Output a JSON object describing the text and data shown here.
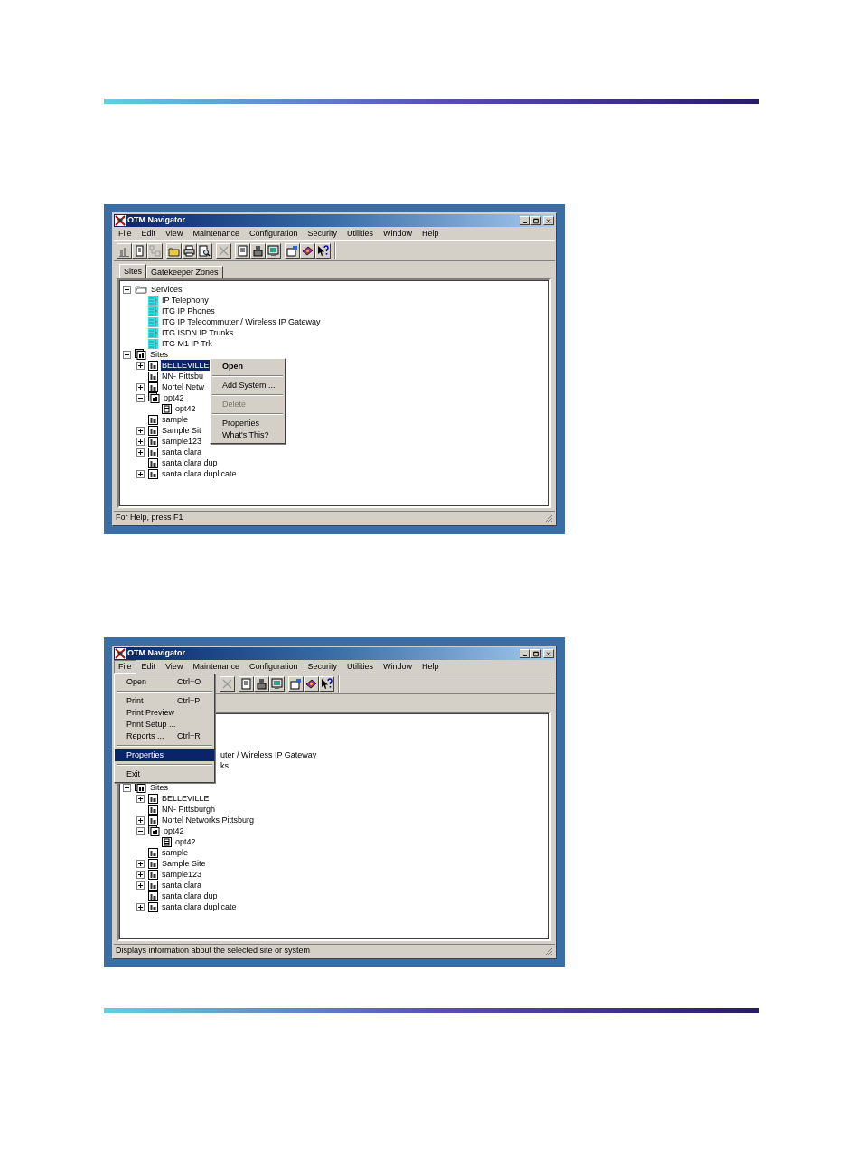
{
  "windows": [
    {
      "title": "OTM Navigator",
      "menu_bar": [
        {
          "label": "File",
          "selected": false
        },
        {
          "label": "Edit",
          "selected": false
        },
        {
          "label": "View",
          "selected": false
        },
        {
          "label": "Maintenance",
          "selected": false
        },
        {
          "label": "Configuration",
          "selected": false
        },
        {
          "label": "Security",
          "selected": false
        },
        {
          "label": "Utilities",
          "selected": false
        },
        {
          "label": "Window",
          "selected": false
        },
        {
          "label": "Help",
          "selected": false
        }
      ],
      "tabs": [
        {
          "label": "Sites",
          "selected": true
        },
        {
          "label": "Gatekeeper Zones",
          "selected": false
        }
      ],
      "tree": [
        {
          "kind": "folder",
          "label": "Services",
          "expanded": true,
          "selected": false,
          "children": [
            {
              "kind": "service",
              "label": "IP Telephony",
              "selected": false
            },
            {
              "kind": "service",
              "label": "ITG IP Phones",
              "selected": false
            },
            {
              "kind": "service",
              "label": "ITG IP Telecommuter / Wireless IP Gateway",
              "selected": false
            },
            {
              "kind": "service",
              "label": "ITG ISDN IP Trunks",
              "selected": false
            },
            {
              "kind": "service",
              "label": "ITG M1 IP Trk",
              "selected": false
            }
          ]
        },
        {
          "kind": "sites",
          "label": "Sites",
          "expanded": true,
          "selected": false,
          "children": [
            {
              "kind": "site",
              "label": "BELLEVILLE",
              "expanded": false,
              "selected": true
            },
            {
              "kind": "site",
              "label": "NN- Pittsbu",
              "selected": false
            },
            {
              "kind": "site",
              "label": "Nortel Netw",
              "expanded": false,
              "selected": false
            },
            {
              "kind": "sites",
              "label": "opt42",
              "expanded": true,
              "selected": false,
              "children": [
                {
                  "kind": "system",
                  "label": "opt42",
                  "selected": false
                }
              ]
            },
            {
              "kind": "site",
              "label": "sample",
              "selected": false
            },
            {
              "kind": "site",
              "label": "Sample Sit",
              "expanded": false,
              "selected": false
            },
            {
              "kind": "site",
              "label": "sample123",
              "expanded": false,
              "selected": false
            },
            {
              "kind": "site",
              "label": "santa clara",
              "expanded": false,
              "selected": false
            },
            {
              "kind": "site",
              "label": "santa clara dup",
              "selected": false
            },
            {
              "kind": "site",
              "label": "santa clara duplicate",
              "expanded": false,
              "selected": false
            }
          ]
        }
      ],
      "context_menu": [
        {
          "kind": "item",
          "label": "Open",
          "default": true,
          "disabled": false,
          "selected": false
        },
        {
          "kind": "separator"
        },
        {
          "kind": "item",
          "label": "Add System ...",
          "default": false,
          "disabled": false,
          "selected": false
        },
        {
          "kind": "separator"
        },
        {
          "kind": "item",
          "label": "Delete",
          "default": false,
          "disabled": true,
          "selected": false
        },
        {
          "kind": "separator"
        },
        {
          "kind": "item",
          "label": "Properties",
          "default": false,
          "disabled": false,
          "selected": false
        },
        {
          "kind": "item",
          "label": "What's This?",
          "default": false,
          "disabled": false,
          "selected": false
        }
      ],
      "status_bar": "For Help, press F1"
    },
    {
      "title": "OTM Navigator",
      "menu_bar": [
        {
          "label": "File",
          "selected": true
        },
        {
          "label": "Edit",
          "selected": false
        },
        {
          "label": "View",
          "selected": false
        },
        {
          "label": "Maintenance",
          "selected": false
        },
        {
          "label": "Configuration",
          "selected": false
        },
        {
          "label": "Security",
          "selected": false
        },
        {
          "label": "Utilities",
          "selected": false
        },
        {
          "label": "Window",
          "selected": false
        },
        {
          "label": "Help",
          "selected": false
        }
      ],
      "file_menu": [
        {
          "kind": "item",
          "label": "Open",
          "shortcut": "Ctrl+O",
          "selected": false
        },
        {
          "kind": "separator"
        },
        {
          "kind": "item",
          "label": "Print",
          "shortcut": "Ctrl+P",
          "selected": false
        },
        {
          "kind": "item",
          "label": "Print Preview",
          "selected": false
        },
        {
          "kind": "item",
          "label": "Print Setup ...",
          "selected": false
        },
        {
          "kind": "item",
          "label": "Reports ...",
          "shortcut": "Ctrl+R",
          "selected": false
        },
        {
          "kind": "separator"
        },
        {
          "kind": "item",
          "label": "Properties",
          "selected": true
        },
        {
          "kind": "separator"
        },
        {
          "kind": "item",
          "label": "Exit",
          "selected": false
        }
      ],
      "tree": [
        {
          "kind": "covered"
        },
        {
          "kind": "covered"
        },
        {
          "kind": "covered"
        },
        {
          "kind": "fragment",
          "label": "uter / Wireless IP Gateway"
        },
        {
          "kind": "fragment",
          "label": "ks"
        },
        {
          "kind": "covered"
        },
        {
          "kind": "sites",
          "label": "Sites",
          "expanded": true,
          "selected": false,
          "children": [
            {
              "kind": "site",
              "label": "BELLEVILLE",
              "expanded": false,
              "selected": false
            },
            {
              "kind": "site",
              "label": "NN- Pittsburgh",
              "selected": false
            },
            {
              "kind": "site",
              "label": "Nortel Networks Pittsburg",
              "expanded": false,
              "selected": false
            },
            {
              "kind": "sites",
              "label": "opt42",
              "expanded": true,
              "selected": false,
              "children": [
                {
                  "kind": "system",
                  "label": "opt42",
                  "selected": false
                }
              ]
            },
            {
              "kind": "site",
              "label": "sample",
              "selected": false
            },
            {
              "kind": "site",
              "label": "Sample Site",
              "expanded": false,
              "selected": false
            },
            {
              "kind": "site",
              "label": "sample123",
              "expanded": false,
              "selected": false
            },
            {
              "kind": "site",
              "label": "santa clara",
              "expanded": false,
              "selected": false
            },
            {
              "kind": "site",
              "label": "santa clara dup",
              "selected": false
            },
            {
              "kind": "site",
              "label": "santa clara duplicate",
              "expanded": false,
              "selected": false
            }
          ]
        }
      ],
      "status_bar": "Displays information about the selected site or system"
    }
  ]
}
